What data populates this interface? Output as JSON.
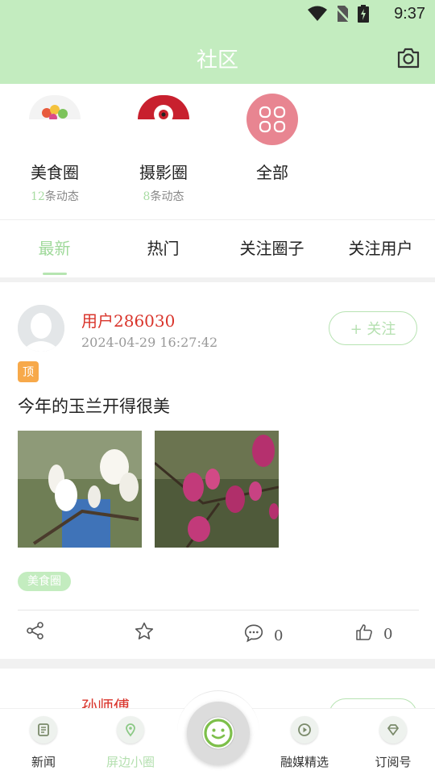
{
  "status": {
    "time": "9:37"
  },
  "header": {
    "title": "社区"
  },
  "circles": [
    {
      "name": "美食圈",
      "count": "12",
      "suffix": "条动态"
    },
    {
      "name": "摄影圈",
      "count": "8",
      "suffix": "条动态"
    },
    {
      "name": "全部"
    }
  ],
  "tabs": [
    "最新",
    "热门",
    "关注圈子",
    "关注用户"
  ],
  "post": {
    "username": "用户286030",
    "timestamp": "2024-04-29 16:27:42",
    "follow_label": "+ 关注",
    "pin_label": "顶",
    "text": "今年的玉兰开得很美",
    "tag": "美食圈",
    "comment_count": "0",
    "like_count": "0"
  },
  "next_post": {
    "username": "孙师傅"
  },
  "nav": {
    "items": [
      "新闻",
      "屏边小圈",
      "融媒精选",
      "订阅号"
    ]
  },
  "colors": {
    "header": "#c3ecbf",
    "accent": "#9fd99a",
    "username": "#d9342b",
    "pin": "#f7a94a"
  }
}
